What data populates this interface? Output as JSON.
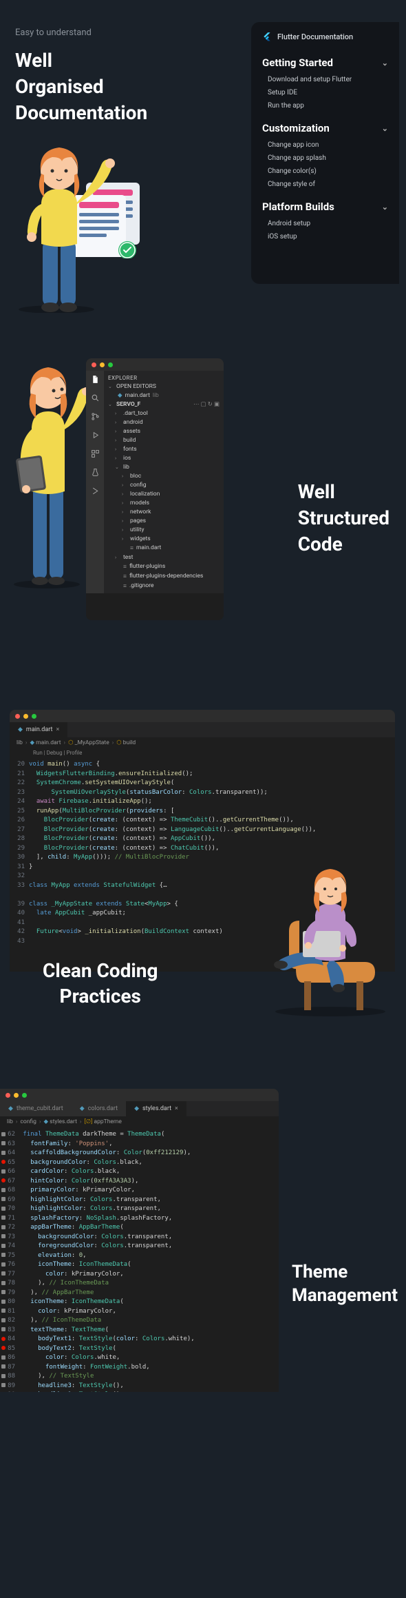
{
  "section1": {
    "subtitle": "Easy to understand",
    "title_l1": "Well",
    "title_l2": "Organised",
    "title_l3": "Documentation",
    "panel": {
      "header": "Flutter Documentation",
      "groups": [
        {
          "title": "Getting Started",
          "items": [
            "Download and setup Flutter",
            "Setup IDE",
            "Run the app"
          ]
        },
        {
          "title": "Customization",
          "items": [
            "Change app icon",
            "Change app splash",
            "Change color(s)",
            "Change style of"
          ]
        },
        {
          "title": "Platform Builds",
          "items": [
            "Android setup",
            "iOS setup"
          ]
        }
      ]
    }
  },
  "section2": {
    "title_l1": "Well",
    "title_l2": "Structured",
    "title_l3": "Code",
    "explorer": {
      "header": "EXPLORER",
      "open_editors": "OPEN EDITORS",
      "open_file": "main.dart",
      "open_file_path": "lib",
      "project": "SERVO_F",
      "tree": [
        {
          "d": 1,
          "exp": true,
          "name": ".dart_tool"
        },
        {
          "d": 1,
          "exp": true,
          "name": "android"
        },
        {
          "d": 1,
          "exp": true,
          "name": "assets"
        },
        {
          "d": 1,
          "exp": true,
          "name": "build"
        },
        {
          "d": 1,
          "exp": true,
          "name": "fonts"
        },
        {
          "d": 1,
          "exp": true,
          "name": "ios"
        },
        {
          "d": 1,
          "exp": false,
          "name": "lib"
        },
        {
          "d": 2,
          "exp": true,
          "name": "bloc"
        },
        {
          "d": 2,
          "exp": true,
          "name": "config"
        },
        {
          "d": 2,
          "exp": true,
          "name": "localization"
        },
        {
          "d": 2,
          "exp": true,
          "name": "models"
        },
        {
          "d": 2,
          "exp": true,
          "name": "network"
        },
        {
          "d": 2,
          "exp": true,
          "name": "pages"
        },
        {
          "d": 2,
          "exp": true,
          "name": "utility"
        },
        {
          "d": 2,
          "exp": true,
          "name": "widgets"
        },
        {
          "d": 2,
          "file": true,
          "name": "main.dart"
        },
        {
          "d": 1,
          "exp": true,
          "name": "test"
        },
        {
          "d": 1,
          "file": true,
          "name": "flutter-plugins"
        },
        {
          "d": 1,
          "file": true,
          "name": "flutter-plugins-dependencies"
        },
        {
          "d": 1,
          "file": true,
          "name": ".gitignore"
        }
      ]
    }
  },
  "section3": {
    "title_l1": "Clean Coding",
    "title_l2": "Practices",
    "tab": "main.dart",
    "breadcrumb": [
      "lib",
      "main.dart",
      "_MyAppState",
      "build"
    ],
    "runbar": "Run | Debug | Profile",
    "code_start": 20
  },
  "section4": {
    "title_l1": "Theme",
    "title_l2": "Management",
    "tabs": [
      "theme_cubit.dart",
      "colors.dart",
      "styles.dart"
    ],
    "active_tab": 2,
    "breadcrumb": [
      "lib",
      "config",
      "styles.dart",
      "appTheme"
    ],
    "code_start": 62
  }
}
